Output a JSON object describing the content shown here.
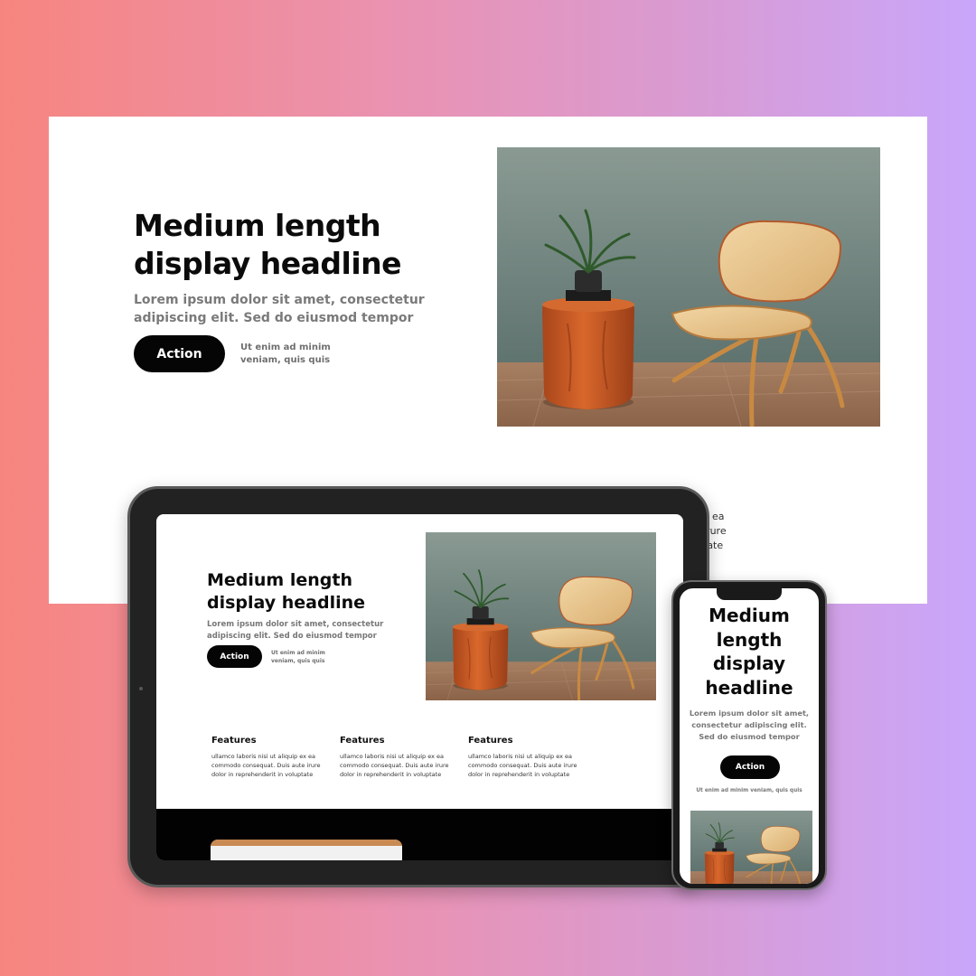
{
  "desktop": {
    "headline": "Medium length display headline",
    "subtitle": "Lorem ipsum dolor sit amet, consectetur adipiscing elit. Sed do eiusmod tempor",
    "action_label": "Action",
    "note": "Ut enim ad minim veniam, quis  quis",
    "peek_text": "x ea\nirure\ntate",
    "image_icon": "chair-and-stool-photo"
  },
  "tablet": {
    "headline": "Medium length display headline",
    "subtitle": "Lorem ipsum dolor sit amet, consectetur adipiscing elit. Sed do eiusmod tempor",
    "action_label": "Action",
    "note": "Ut enim ad minim veniam, quis  quis",
    "features": [
      {
        "title": "Features",
        "text": "ullamco laboris nisi ut aliquip ex ea commodo consequat. Duis aute irure dolor in reprehenderit in voluptate"
      },
      {
        "title": "Features",
        "text": "ullamco laboris nisi ut aliquip ex ea commodo consequat. Duis aute irure dolor in reprehenderit in voluptate"
      },
      {
        "title": "Features",
        "text": "ullamco laboris nisi ut aliquip ex ea commodo consequat. Duis aute irure dolor in reprehenderit in voluptate"
      }
    ]
  },
  "phone": {
    "headline": "Medium length display headline",
    "subtitle": "Lorem ipsum dolor sit amet, consectetur adipiscing elit. Sed do eiusmod tempor",
    "action_label": "Action",
    "note": "Ut enim ad minim veniam, quis  quis"
  },
  "colors": {
    "gradient_left": "#f7857f",
    "gradient_right": "#c9a6fb",
    "button": "#050505",
    "wall": "#6f8580",
    "stool": "#c95a23",
    "chair_wood": "#e9c58d"
  }
}
